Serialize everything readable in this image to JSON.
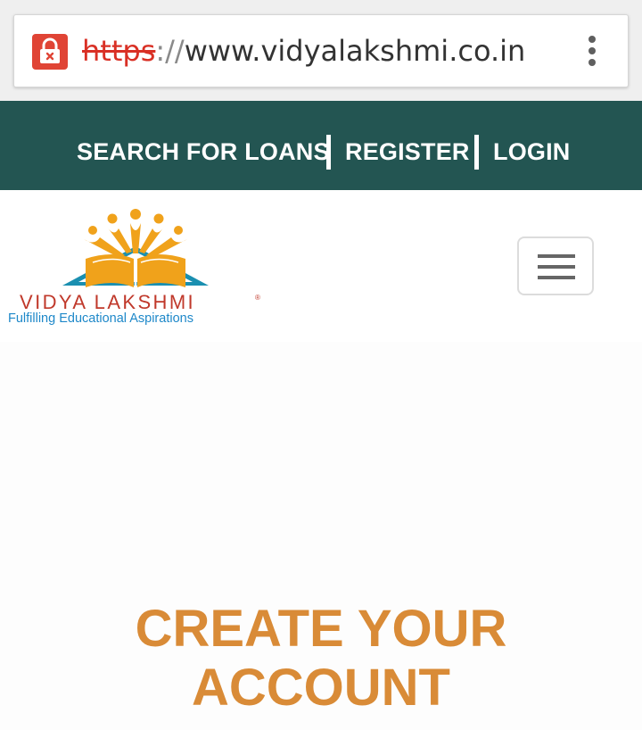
{
  "browser": {
    "url_scheme": "https",
    "url_separator": "://",
    "url_host": "www.vidyalakshmi.co.in",
    "security_icon": "broken-lock-icon",
    "menu_icon": "vertical-dots-icon",
    "colors": {
      "security_warning": "#e04435"
    }
  },
  "topnav": {
    "items": [
      {
        "label": "SEARCH FOR LOANS"
      },
      {
        "label": "REGISTER"
      },
      {
        "label": "LOGIN"
      }
    ],
    "colors": {
      "background": "#235552",
      "text": "#ffffff"
    }
  },
  "brand": {
    "name": "VIDYA LAKSHMI",
    "registered_mark": "®",
    "tagline": "Fulfilling Educational Aspirations",
    "menu_icon": "hamburger-menu-icon",
    "colors": {
      "name": "#c0392b",
      "tagline": "#1e88c9",
      "logo_orange": "#f0a21b",
      "logo_teal": "#1a8fb0"
    }
  },
  "main": {
    "title": "CREATE YOUR ACCOUNT",
    "colors": {
      "title": "#d98b37"
    }
  }
}
